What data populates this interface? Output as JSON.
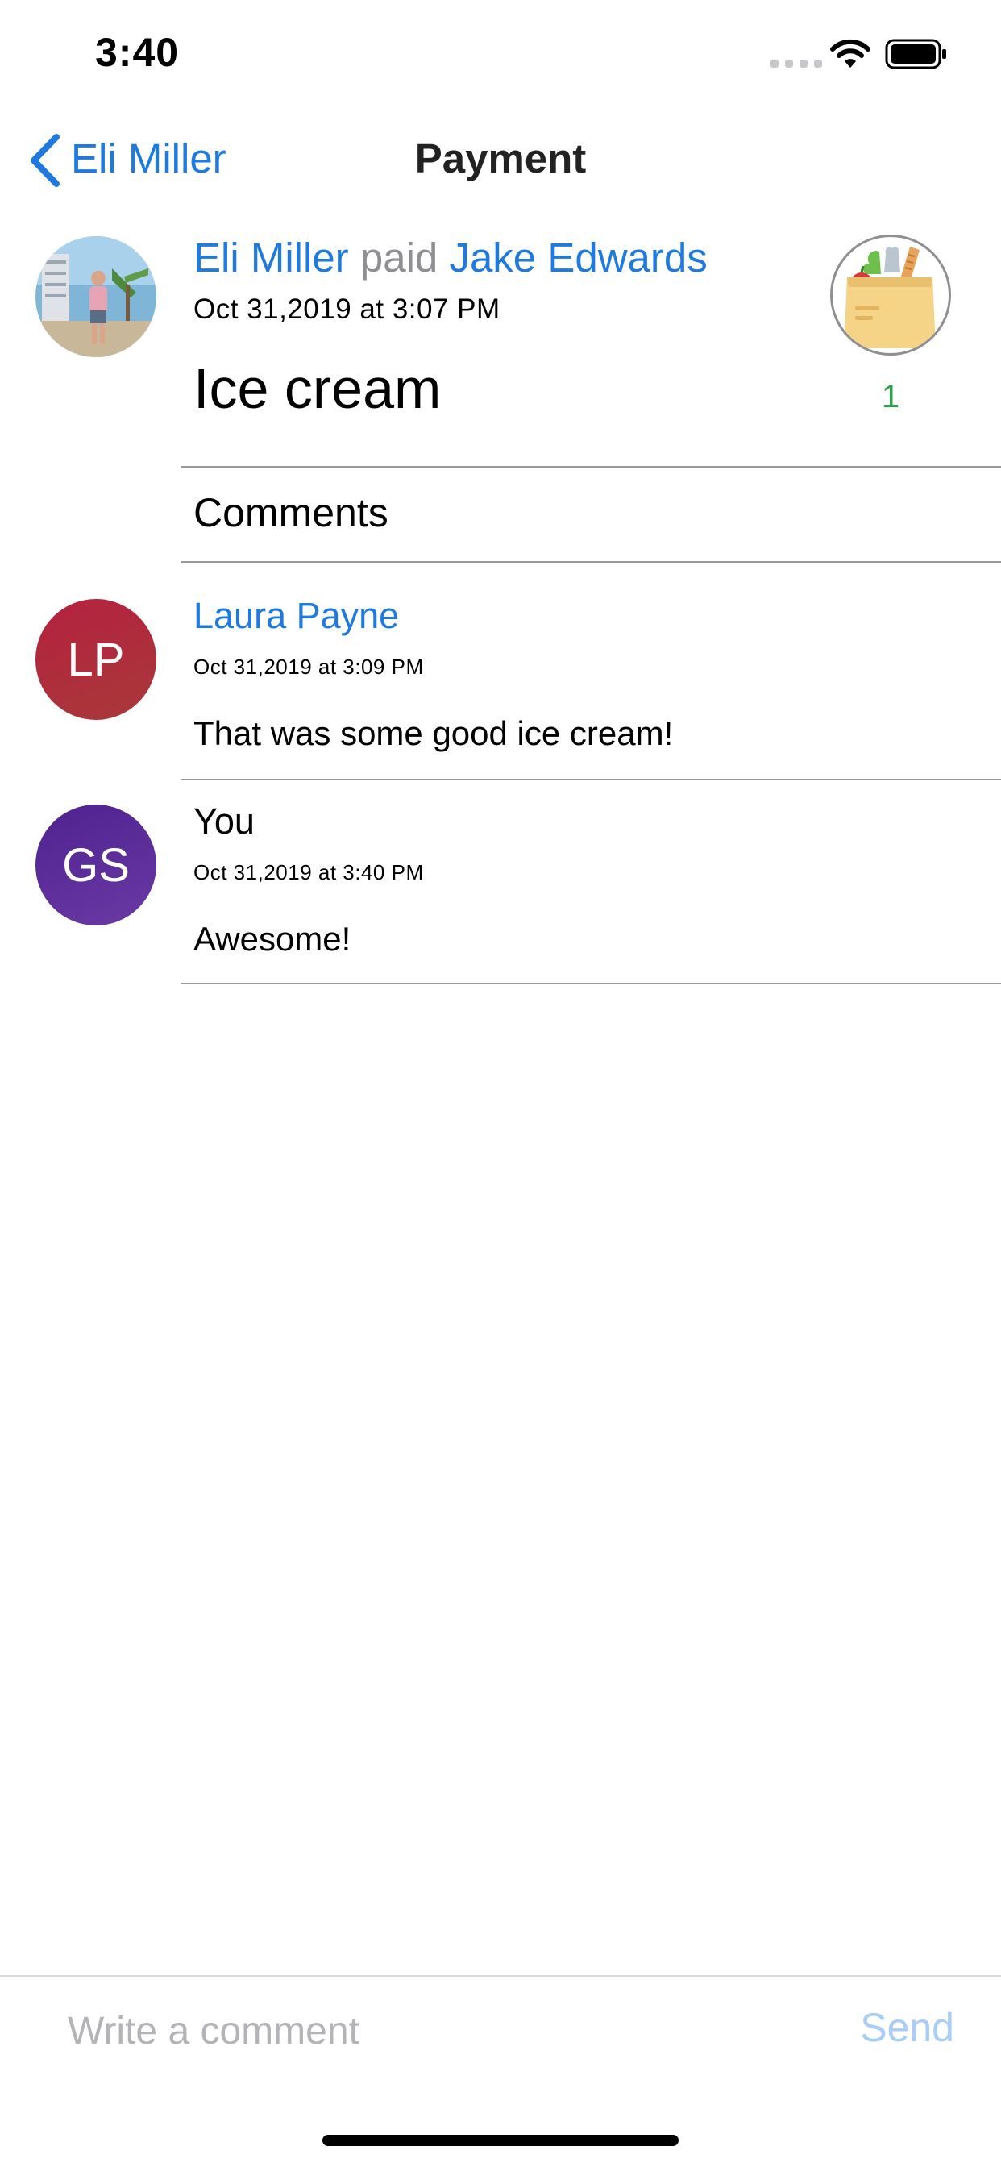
{
  "status_bar": {
    "time": "3:40"
  },
  "nav": {
    "back_label": "Eli Miller",
    "title": "Payment"
  },
  "payment": {
    "payer": "Eli Miller",
    "verb": "paid",
    "payee": "Jake Edwards",
    "date": "Oct 31,2019 at 3:07 PM",
    "description": "Ice cream",
    "category_icon": "grocery-bag-icon",
    "likes": "1"
  },
  "comments_heading": "Comments",
  "comments": [
    {
      "initials": "LP",
      "name": "Laura Payne",
      "date": "Oct 31,2019 at 3:09 PM",
      "text": "That was some good ice cream!"
    },
    {
      "initials": "GS",
      "name": "You",
      "date": "Oct 31,2019 at 3:40 PM",
      "text": "Awesome!"
    }
  ],
  "composer": {
    "placeholder": "Write a comment",
    "send_label": "Send"
  },
  "colors": {
    "link": "#1f7ae0",
    "likes": "#2aa048",
    "avatar_lp": "#b0283c",
    "avatar_gs": "#5b2a95",
    "send_disabled": "#a8cdf6"
  }
}
